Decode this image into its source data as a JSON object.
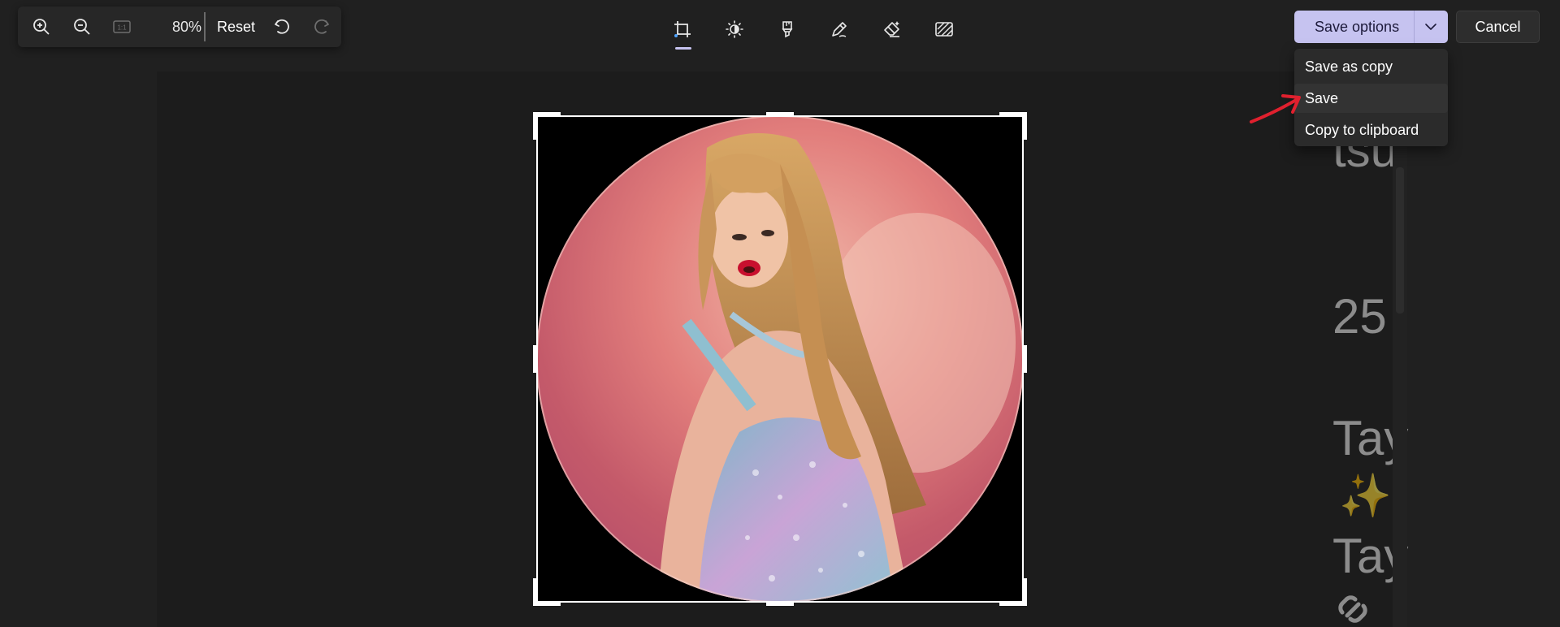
{
  "zoom_toolbar": {
    "zoom_level": "80%",
    "reset_label": "Reset",
    "icons": [
      "zoom-in-icon",
      "zoom-out-icon",
      "actual-size-icon",
      "undo-icon",
      "redo-icon"
    ],
    "actual_size_glyph": "1:1"
  },
  "tools": {
    "items": [
      "crop-icon",
      "adjust-brightness-icon",
      "filter-icon",
      "markup-pen-icon",
      "erase-icon",
      "background-blur-icon"
    ],
    "active": "crop-icon"
  },
  "save": {
    "save_options_label": "Save options",
    "cancel_label": "Cancel",
    "menu_items": [
      "Save as copy",
      "Save",
      "Copy to clipboard"
    ]
  },
  "background_doc": {
    "line1": "tsu",
    "line2": "25",
    "line3": "Tay",
    "line4": "Tay",
    "sparkle": "✨"
  },
  "colors": {
    "accent": "#c6c3f0",
    "background": "#202020",
    "annotation_arrow": "#e0202e"
  }
}
